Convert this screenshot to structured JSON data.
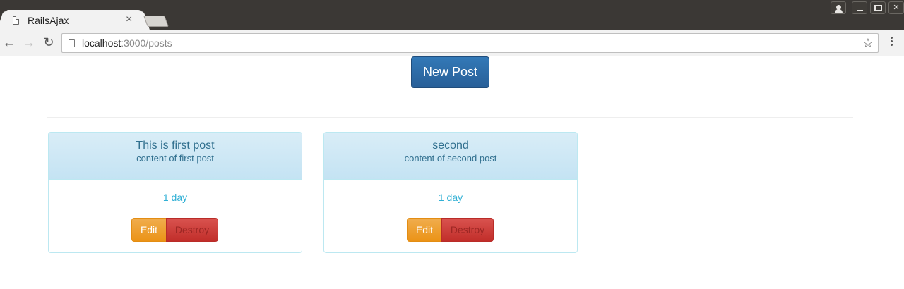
{
  "browser": {
    "tab_title": "RailsAjax",
    "tab_close": "×",
    "url_host": "localhost",
    "url_path": ":3000/posts"
  },
  "page": {
    "new_post_label": "New Post"
  },
  "posts": [
    {
      "title": "This is first post",
      "content": "content of first post",
      "time": "1 day",
      "edit_label": "Edit",
      "destroy_label": "Destroy"
    },
    {
      "title": "second",
      "content": "content of second post",
      "time": "1 day",
      "edit_label": "Edit",
      "destroy_label": "Destroy"
    }
  ],
  "colors": {
    "primary": "#337ab7",
    "info_text": "#31708f",
    "info_bg": "#d9edf7",
    "warning": "#f0ad4e",
    "danger": "#d9534f"
  }
}
